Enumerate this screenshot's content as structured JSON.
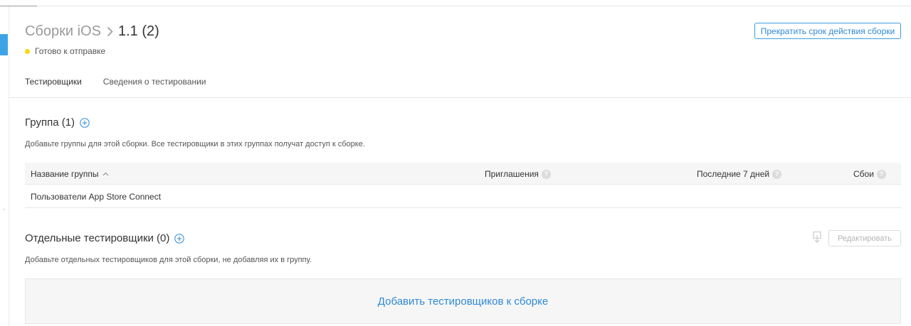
{
  "breadcrumb": {
    "parent": "Сборки iOS",
    "separator_icon": "chevron-right-icon",
    "current": "1.1 (2)"
  },
  "status": {
    "label": "Готово к отправке",
    "color": "#f5d90f"
  },
  "actions": {
    "expire_label": "Прекратить срок действия сборки",
    "edit_label": "Редактировать"
  },
  "tabs": [
    {
      "label": "Тестировщики",
      "active": true
    },
    {
      "label": "Сведения о тестировании",
      "active": false
    }
  ],
  "groups_section": {
    "title": "Группа (1)",
    "description": "Добавьте группы для этой сборки. Все тестировщики в этих группах получат доступ к сборке.",
    "columns": [
      {
        "label": "Название группы",
        "sortable": true,
        "help": false
      },
      {
        "label": "Приглашения",
        "sortable": false,
        "help": true
      },
      {
        "label": "Последние 7 дней",
        "sortable": false,
        "help": true
      },
      {
        "label": "Сбои",
        "sortable": false,
        "help": true
      }
    ],
    "rows": [
      {
        "name": "Пользователи App Store Connect"
      }
    ],
    "help_glyph": "?"
  },
  "individual_section": {
    "title": "Отдельные тестировщики (0)",
    "description": "Добавьте отдельных тестировщиков для этой сборки, не добавляя их в группу.",
    "add_link": "Добавить тестировщиков к сборке"
  },
  "colors": {
    "accent": "#2f8ad8",
    "sidebar_accent": "#3ea3e6"
  }
}
